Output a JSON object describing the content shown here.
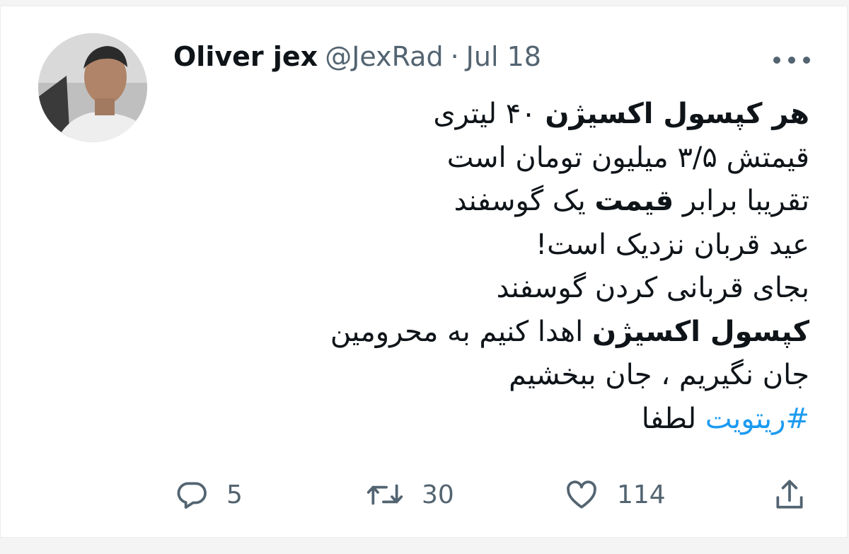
{
  "tweet": {
    "author_name": "Oliver jex",
    "handle": "@JexRad",
    "separator": "·",
    "date": "Jul 18",
    "lines": [
      [
        {
          "t": "هر کپسول اکسیژن",
          "b": true
        },
        {
          "t": " ۴۰ لیتری"
        }
      ],
      [
        {
          "t": "قیمتش ۳/۵ میلیون تومان است"
        }
      ],
      [
        {
          "t": "تقریبا برابر "
        },
        {
          "t": "قیمت",
          "b": true
        },
        {
          "t": " یک گوسفند"
        }
      ],
      [
        {
          "t": "عید قربان نزدیک است!"
        }
      ],
      [
        {
          "t": "بجای قربانی کردن گوسفند"
        }
      ],
      [
        {
          "t": "کپسول اکسیژن",
          "b": true
        },
        {
          "t": " اهدا کنیم به محرومین"
        }
      ],
      [
        {
          "t": "جان نگیریم ، جان ببخشیم"
        }
      ],
      [
        {
          "t": "#ریتویت",
          "link": true
        },
        {
          "t": " لطفا"
        }
      ]
    ]
  },
  "actions": {
    "reply": {
      "icon": "reply-icon",
      "count": "5"
    },
    "retweet": {
      "icon": "retweet-icon",
      "count": "30"
    },
    "like": {
      "icon": "heart-icon",
      "count": "114"
    },
    "share": {
      "icon": "share-icon"
    }
  },
  "colors": {
    "text": "#0f1419",
    "secondary": "#536471",
    "link": "#1d9bf0"
  }
}
